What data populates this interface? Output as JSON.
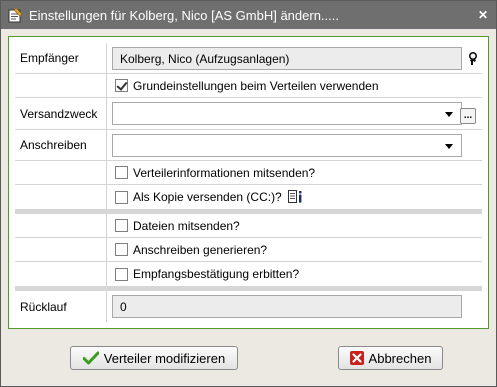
{
  "window": {
    "title": "Einstellungen für Kolberg, Nico [AS GmbH] ändern.....",
    "close_label": "✕"
  },
  "form": {
    "empfaenger_label": "Empfänger",
    "empfaenger_value": "Kolberg, Nico (Aufzugsanlagen)",
    "grundeinstellungen_label": "Grundeinstellungen beim Verteilen verwenden",
    "grundeinstellungen_checked": true,
    "versandzweck_label": "Versandzweck",
    "versandzweck_value": "",
    "dots_label": "...",
    "anschreiben_label": "Anschreiben",
    "anschreiben_value": "",
    "verteilerinfo_label": "Verteilerinformationen mitsenden?",
    "kopie_label": "Als Kopie versenden (CC:)?",
    "dateien_label": "Dateien mitsenden?",
    "anschreiben_gen_label": "Anschreiben generieren?",
    "empfangsbestaetigung_label": "Empfangsbestätigung erbitten?",
    "ruecklauf_label": "Rücklauf",
    "ruecklauf_value": "0"
  },
  "buttons": {
    "modify_label": "Verteiler modifizieren",
    "cancel_label": "Abbrechen"
  },
  "icons": {
    "title": "settings-dialog-icon",
    "person": "person-search-icon",
    "info": "info-list-icon",
    "check": "green-check-icon",
    "cancel": "red-x-icon"
  },
  "colors": {
    "titlebar": "#6f6f6f",
    "panel_border": "#4f9a2b",
    "check_green": "#3a9d1e",
    "cancel_red": "#c8201a"
  }
}
